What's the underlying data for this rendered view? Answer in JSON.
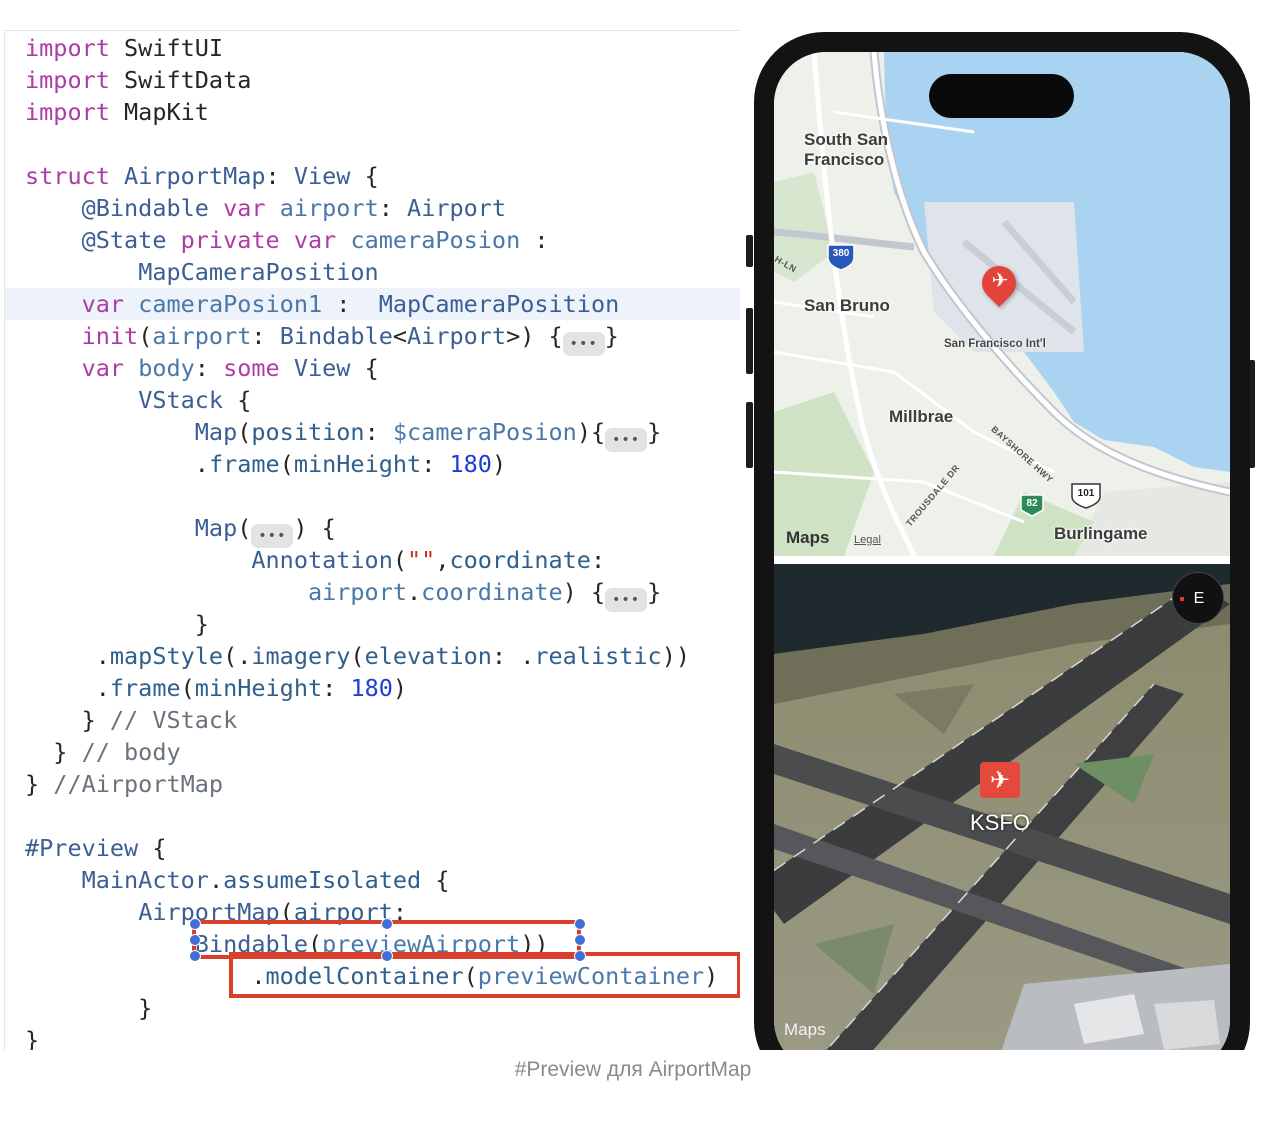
{
  "editor": {
    "lines": [
      [
        {
          "c": "kw",
          "t": "import"
        },
        {
          "c": "pl",
          "t": " SwiftUI"
        }
      ],
      [
        {
          "c": "kw",
          "t": "import"
        },
        {
          "c": "pl",
          "t": " SwiftData"
        }
      ],
      [
        {
          "c": "kw",
          "t": "import"
        },
        {
          "c": "pl",
          "t": " MapKit"
        }
      ],
      [],
      [
        {
          "c": "kw",
          "t": "struct"
        },
        {
          "c": "pl",
          "t": " "
        },
        {
          "c": "ty",
          "t": "AirportMap"
        },
        {
          "c": "pl",
          "t": ": "
        },
        {
          "c": "ty",
          "t": "View"
        },
        {
          "c": "pl",
          "t": " {"
        }
      ],
      [
        {
          "c": "pl",
          "t": "    "
        },
        {
          "c": "ty",
          "t": "@Bindable"
        },
        {
          "c": "pl",
          "t": " "
        },
        {
          "c": "kw",
          "t": "var"
        },
        {
          "c": "pl",
          "t": " "
        },
        {
          "c": "pr",
          "t": "airport"
        },
        {
          "c": "pl",
          "t": ": "
        },
        {
          "c": "ty",
          "t": "Airport"
        }
      ],
      [
        {
          "c": "pl",
          "t": "    "
        },
        {
          "c": "ty",
          "t": "@State"
        },
        {
          "c": "pl",
          "t": " "
        },
        {
          "c": "kw",
          "t": "private"
        },
        {
          "c": "pl",
          "t": " "
        },
        {
          "c": "kw",
          "t": "var"
        },
        {
          "c": "pl",
          "t": " "
        },
        {
          "c": "pr",
          "t": "cameraPosion"
        },
        {
          "c": "pl",
          "t": " :"
        }
      ],
      [
        {
          "c": "pl",
          "t": "        "
        },
        {
          "c": "ty",
          "t": "MapCameraPosition"
        }
      ],
      [
        {
          "c": "pl",
          "t": "    "
        },
        {
          "c": "kw",
          "t": "var"
        },
        {
          "c": "pl",
          "t": " "
        },
        {
          "c": "pr",
          "t": "cameraPosion1"
        },
        {
          "c": "pl",
          "t": " :  "
        },
        {
          "c": "ty",
          "t": "MapCameraPosition"
        }
      ],
      [
        {
          "c": "pl",
          "t": "    "
        },
        {
          "c": "kw",
          "t": "init"
        },
        {
          "c": "pl",
          "t": "("
        },
        {
          "c": "pr",
          "t": "airport"
        },
        {
          "c": "pl",
          "t": ": "
        },
        {
          "c": "ty",
          "t": "Bindable"
        },
        {
          "c": "pl",
          "t": "<"
        },
        {
          "c": "ty",
          "t": "Airport"
        },
        {
          "c": "pl",
          "t": ">) {"
        },
        {
          "c": "fold",
          "t": "•••"
        },
        {
          "c": "pl",
          "t": "}"
        }
      ],
      [
        {
          "c": "pl",
          "t": "    "
        },
        {
          "c": "kw",
          "t": "var"
        },
        {
          "c": "pl",
          "t": " "
        },
        {
          "c": "pr",
          "t": "body"
        },
        {
          "c": "pl",
          "t": ": "
        },
        {
          "c": "kw",
          "t": "some"
        },
        {
          "c": "pl",
          "t": " "
        },
        {
          "c": "ty",
          "t": "View"
        },
        {
          "c": "pl",
          "t": " {"
        }
      ],
      [
        {
          "c": "pl",
          "t": "        "
        },
        {
          "c": "ty",
          "t": "VStack"
        },
        {
          "c": "pl",
          "t": " {"
        }
      ],
      [
        {
          "c": "pl",
          "t": "            "
        },
        {
          "c": "ty",
          "t": "Map"
        },
        {
          "c": "pl",
          "t": "("
        },
        {
          "c": "fn",
          "t": "position"
        },
        {
          "c": "pl",
          "t": ": "
        },
        {
          "c": "pr",
          "t": "$cameraPosion"
        },
        {
          "c": "pl",
          "t": "){"
        },
        {
          "c": "fold",
          "t": "•••"
        },
        {
          "c": "pl",
          "t": "}"
        }
      ],
      [
        {
          "c": "pl",
          "t": "            ."
        },
        {
          "c": "fn",
          "t": "frame"
        },
        {
          "c": "pl",
          "t": "("
        },
        {
          "c": "fn",
          "t": "minHeight"
        },
        {
          "c": "pl",
          "t": ": "
        },
        {
          "c": "nu",
          "t": "180"
        },
        {
          "c": "pl",
          "t": ")"
        }
      ],
      [],
      [
        {
          "c": "pl",
          "t": "            "
        },
        {
          "c": "ty",
          "t": "Map"
        },
        {
          "c": "pl",
          "t": "("
        },
        {
          "c": "fold",
          "t": "•••"
        },
        {
          "c": "pl",
          "t": ") {"
        }
      ],
      [
        {
          "c": "pl",
          "t": "                "
        },
        {
          "c": "ty",
          "t": "Annotation"
        },
        {
          "c": "pl",
          "t": "("
        },
        {
          "c": "st",
          "t": "\"\""
        },
        {
          "c": "pl",
          "t": ","
        },
        {
          "c": "fn",
          "t": "coordinate"
        },
        {
          "c": "pl",
          "t": ":"
        }
      ],
      [
        {
          "c": "pl",
          "t": "                    "
        },
        {
          "c": "pr",
          "t": "airport"
        },
        {
          "c": "pl",
          "t": "."
        },
        {
          "c": "pr",
          "t": "coordinate"
        },
        {
          "c": "pl",
          "t": ") {"
        },
        {
          "c": "fold",
          "t": "•••"
        },
        {
          "c": "pl",
          "t": "}"
        }
      ],
      [
        {
          "c": "pl",
          "t": "            }"
        }
      ],
      [
        {
          "c": "pl",
          "t": "     ."
        },
        {
          "c": "fn",
          "t": "mapStyle"
        },
        {
          "c": "pl",
          "t": "(."
        },
        {
          "c": "fn",
          "t": "imagery"
        },
        {
          "c": "pl",
          "t": "("
        },
        {
          "c": "fn",
          "t": "elevation"
        },
        {
          "c": "pl",
          "t": ": ."
        },
        {
          "c": "fn",
          "t": "realistic"
        },
        {
          "c": "pl",
          "t": "))"
        }
      ],
      [
        {
          "c": "pl",
          "t": "     ."
        },
        {
          "c": "fn",
          "t": "frame"
        },
        {
          "c": "pl",
          "t": "("
        },
        {
          "c": "fn",
          "t": "minHeight"
        },
        {
          "c": "pl",
          "t": ": "
        },
        {
          "c": "nu",
          "t": "180"
        },
        {
          "c": "pl",
          "t": ")"
        }
      ],
      [
        {
          "c": "pl",
          "t": "    } "
        },
        {
          "c": "cm",
          "t": "// VStack"
        }
      ],
      [
        {
          "c": "pl",
          "t": "  } "
        },
        {
          "c": "cm",
          "t": "// body"
        }
      ],
      [
        {
          "c": "pl",
          "t": "} "
        },
        {
          "c": "cm",
          "t": "//AirportMap"
        }
      ],
      [],
      [
        {
          "c": "ty",
          "t": "#Preview"
        },
        {
          "c": "pl",
          "t": " {"
        }
      ],
      [
        {
          "c": "pl",
          "t": "    "
        },
        {
          "c": "ty",
          "t": "MainActor"
        },
        {
          "c": "pl",
          "t": "."
        },
        {
          "c": "fn",
          "t": "assumeIsolated"
        },
        {
          "c": "pl",
          "t": " {"
        }
      ],
      [
        {
          "c": "pl",
          "t": "        "
        },
        {
          "c": "ty",
          "t": "AirportMap"
        },
        {
          "c": "pl",
          "t": "("
        },
        {
          "c": "fn",
          "t": "airport"
        },
        {
          "c": "pl",
          "t": ":"
        }
      ],
      [
        {
          "c": "pl",
          "t": "            "
        },
        {
          "c": "ty",
          "t": "Bindable"
        },
        {
          "c": "pl",
          "t": "("
        },
        {
          "c": "pr",
          "t": "previewAirport"
        },
        {
          "c": "pl",
          "t": "))"
        }
      ],
      [
        {
          "c": "pl",
          "t": "                ."
        },
        {
          "c": "fn",
          "t": "modelContainer"
        },
        {
          "c": "pl",
          "t": "("
        },
        {
          "c": "pr",
          "t": "previewContainer"
        },
        {
          "c": "pl",
          "t": ")"
        }
      ],
      [
        {
          "c": "pl",
          "t": "        }"
        }
      ],
      [
        {
          "c": "pl",
          "t": "}"
        }
      ]
    ]
  },
  "preview": {
    "top_map": {
      "city_labels": [
        "South San\nFrancisco",
        "San Bruno",
        "Millbrae",
        "Burlingame"
      ],
      "airport_label": "San Francisco Int'l",
      "road_labels": [
        "BAYSHORE HWY",
        "TROUSDALE DR",
        "H-LN"
      ],
      "highway_shields": [
        "380",
        "101",
        "82"
      ],
      "maps_mark": "Maps",
      "legal": "Legal"
    },
    "bottom_map": {
      "compass": "E",
      "annotation_label": "KSFO",
      "maps_mark": "Maps"
    }
  },
  "caption": "#Preview для AirportMap",
  "colors": {
    "keyword": "#ad3da4",
    "type": "#3b5f93",
    "number": "#1c3ed6",
    "string": "#d12f1b",
    "highlight_box": "#d8402c",
    "selection_handle": "#3f6fd6",
    "water": "#a9d3f0",
    "land": "#eef0ea"
  },
  "icons": [
    "airplane-icon",
    "apple-logo-icon",
    "compass-icon",
    "fold-ellipsis-icon"
  ]
}
